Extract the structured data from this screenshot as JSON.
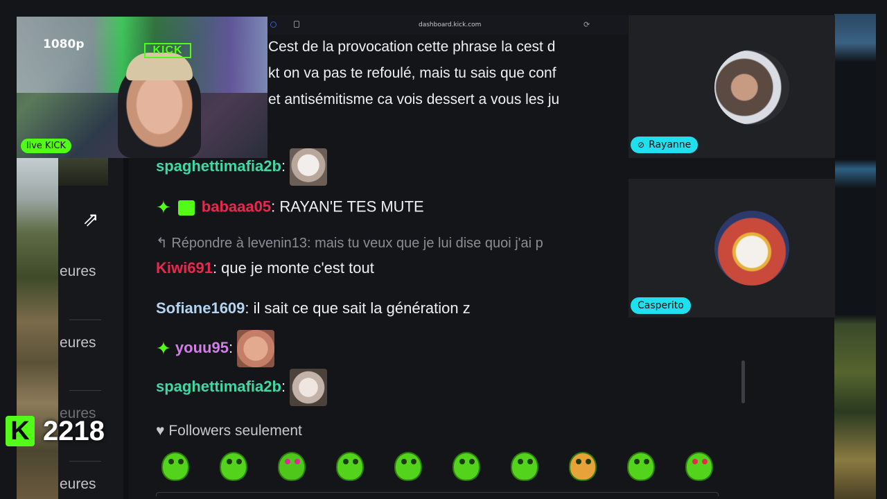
{
  "browser": {
    "url": "dashboard.kick.com"
  },
  "webcam": {
    "resolution_badge": "1080p",
    "live_badge": "live KICK",
    "wall_logo": "KICK"
  },
  "viewer_counter": {
    "logo": "K",
    "count": "2218"
  },
  "sidebar": {
    "items": [
      "eures",
      "eures",
      "eures",
      "eures"
    ]
  },
  "chat": {
    "top_lines": [
      "Cest de la provocation cette phrase la cest d",
      "kt on va pas te refoulé, mais tu sais que conf",
      "et antisémitisme ca vois dessert a vous les ju"
    ],
    "messages": [
      {
        "user": "spaghettimafia2b",
        "sep": ":",
        "text": "",
        "emote": "cat",
        "user_color": "#3fd9a5"
      },
      {
        "user": "babaaa05",
        "sep": ":",
        "text": " RAYAN'E TES MUTE",
        "user_color": "#e8294f"
      },
      {
        "reply": "Répondre à levenin13: mais tu veux que je lui dise quoi j'ai p"
      },
      {
        "user": "Kiwi691",
        "sep": ":",
        "text": " que je monte c'est tout",
        "user_color": "#e8294f"
      },
      {
        "user": "Sofiane1609",
        "sep": ":",
        "text": " il sait ce que sait la génération z",
        "user_color": "#b3d3ef"
      },
      {
        "user": "youu95",
        "sep": ":",
        "text": "",
        "emote": "face",
        "user_color": "#d27de8"
      },
      {
        "user": "spaghettimafia2b",
        "sep": ":",
        "text": "",
        "emote": "rat",
        "user_color": "#3fd9a5"
      }
    ],
    "followers_mode": "Followers seulement"
  },
  "call": {
    "participants": [
      {
        "name": "Rayanne",
        "muted": true
      },
      {
        "name": "Casperito",
        "muted": false
      }
    ]
  },
  "colors": {
    "kick_green": "#53fc18",
    "chip_cyan": "#20e0f0",
    "bg": "#141519"
  }
}
